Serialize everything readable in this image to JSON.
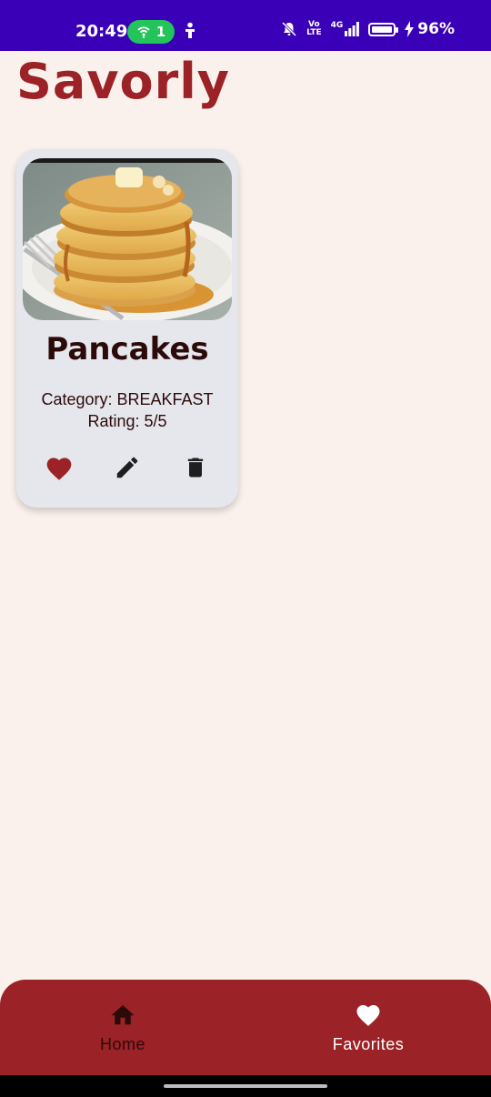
{
  "status_bar": {
    "time": "20:49",
    "hotspot_count": "1",
    "volte_top": "Vo",
    "volte_bottom": "LTE",
    "network": "4G",
    "battery": "96%"
  },
  "app": {
    "title": "Savorly"
  },
  "recipes": [
    {
      "name": "Pancakes",
      "category": "Category: BREAKFAST",
      "rating": "Rating: 5/5",
      "is_favorite": true,
      "image_alt": "stack-of-pancakes-with-syrup"
    }
  ],
  "icons": {
    "favorite": "heart-icon",
    "edit": "pencil-icon",
    "delete": "trash-icon",
    "home": "home-icon",
    "favorites_nav": "heart-icon"
  },
  "bottom_nav": {
    "items": [
      {
        "label": "Home",
        "active": true
      },
      {
        "label": "Favorites",
        "active": false
      }
    ]
  },
  "colors": {
    "brand": "#9b2226",
    "background": "#faf1ec",
    "card": "#e6e7ec",
    "status_bar": "#3a00b8",
    "text_dark": "#2b0a0a"
  }
}
